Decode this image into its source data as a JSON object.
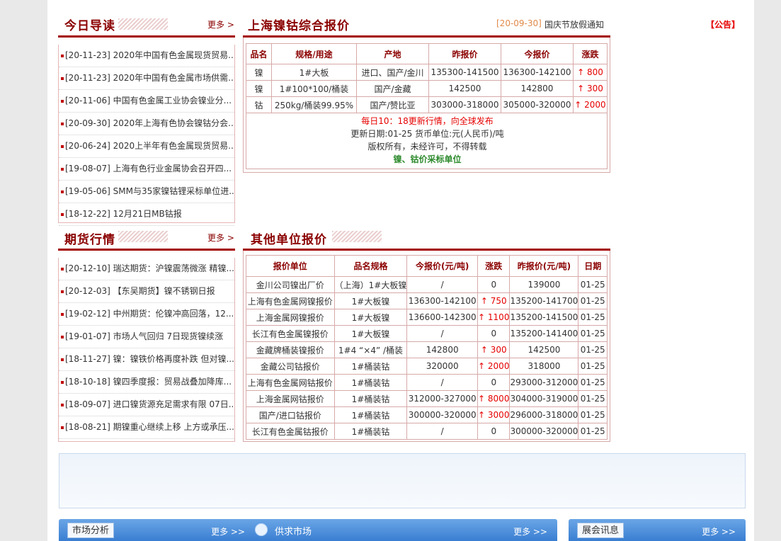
{
  "today": {
    "title": "今日导读",
    "more": "更多 >",
    "items": [
      "[20-11-23] 2020年中国有色金属现货贸易...",
      "[20-11-23] 2020年中国有色金属市场供需...",
      "[20-11-06] 中国有色金属工业协会镍业分...",
      "[20-09-30] 2020年上海有色协会镍钴分会...",
      "[20-06-24] 2020上半年有色金属现货贸易...",
      "[19-08-07] 上海有色行业金属协会召开四...",
      "[19-05-06] SMM与35家镍钴锂采标单位进...",
      "[18-12-22] 12月21日MB钴报"
    ]
  },
  "futures": {
    "title": "期货行情",
    "more": "更多 >",
    "items": [
      "[20-12-10] 瑞达期货：沪镍震荡微涨 精镍...",
      "[20-12-03] 【东吴期货】镍不锈钢日报",
      "[19-02-12] 中州期货：伦镍冲高回落，12...",
      "[19-01-07] 市场人气回归 7日现货镍续涨",
      "[18-11-27] 镍：镍铁价格再度补跌 但对镍...",
      "[18-10-18] 镍四季度报：贸易战叠加降库...",
      "[18-09-07] 进口镍货源充足需求有限 07日...",
      "[18-08-21] 期镍重心继续上移 上方或承压..."
    ]
  },
  "shanghai": {
    "title": "上海镍钴综合报价",
    "date": "[20-09-30]",
    "notice_link": "国庆节放假通知",
    "announce": "【公告】",
    "headers": [
      "品名",
      "规格/用途",
      "产地",
      "昨报价",
      "今报价",
      "涨跌"
    ],
    "rows": [
      [
        "镍",
        "1#大板",
        "进口、国产/金川",
        "135300-141500",
        "136300-142100",
        "↑ 800"
      ],
      [
        "镍",
        "1#100*100/桶装",
        "国产/金藏",
        "142500",
        "142800",
        "↑ 300"
      ],
      [
        "钴",
        "250kg/桶装99.95%",
        "国产/赞比亚",
        "303000-318000",
        "305000-320000",
        "↑ 2000"
      ]
    ],
    "note1": "每日10：18更新行情，向全球发布",
    "note2": "更新日期:01-25 货币单位:元(人民币)/吨",
    "note3": "版权所有，未经许可，不得转载",
    "note4": "镍、钴价采标单位"
  },
  "others": {
    "title": "其他单位报价",
    "headers": [
      "报价单位",
      "品名规格",
      "今报价(元/吨)",
      "涨跌",
      "昨报价(元/吨)",
      "日期"
    ],
    "rows": [
      [
        "金川公司镍出厂价",
        "（上海）1#大板镍",
        "/",
        "0",
        "139000",
        "01-25"
      ],
      [
        "上海有色金属网镍报价",
        "1#大板镍",
        "136300-142100",
        "↑ 750",
        "135200-141700",
        "01-25"
      ],
      [
        "上海金属网镍报价",
        "1#大板镍",
        "136600-142300",
        "↑ 1100",
        "135200-141500",
        "01-25"
      ],
      [
        "长江有色金属镍报价",
        "1#大板镍",
        "/",
        "0",
        "135200-141400",
        "01-25"
      ],
      [
        "金藏牌桶装镍报价",
        "1#4 “×4” /桶装",
        "142800",
        "↑ 300",
        "142500",
        "01-25"
      ],
      [
        "金藏公司钴报价",
        "1#桶装钴",
        "320000",
        "↑ 2000",
        "318000",
        "01-25"
      ],
      [
        "上海有色金属网钴报价",
        "1#桶装钴",
        "/",
        "0",
        "293000-312000",
        "01-25"
      ],
      [
        "上海金属网钴报价",
        "1#桶装钴",
        "312000-327000",
        "↑ 8000",
        "304000-319000",
        "01-25"
      ],
      [
        "国产/进口钴报价",
        "1#桶装钴",
        "300000-320000",
        "↑ 3000",
        "296000-318000",
        "01-25"
      ],
      [
        "长江有色金属钴报价",
        "1#桶装钴",
        "/",
        "0",
        "300000-320000",
        "01-25"
      ]
    ]
  },
  "bottom": {
    "market_tab": "市场分析",
    "market_more": "更多 >>",
    "supply_tab": "供求市场",
    "supply_more": "更多 >>",
    "expo_tab": "展会讯息",
    "expo_more": "更多 >>"
  },
  "colors": {
    "accent": "#8b0000",
    "rise": "#e60000",
    "green": "#2e8b2e",
    "bar_blue": "#3a7ed2"
  }
}
